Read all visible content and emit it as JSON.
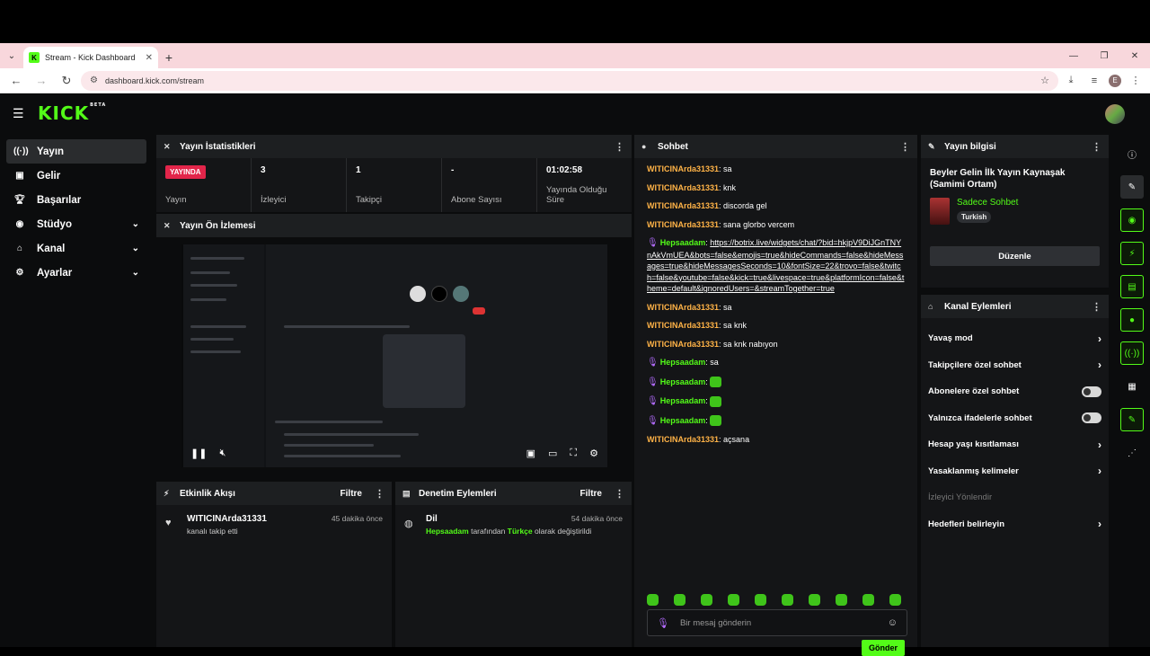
{
  "browser": {
    "tab_title": "Stream - Kick Dashboard",
    "url": "dashboard.kick.com/stream",
    "profile_letter": "E"
  },
  "app": {
    "logo": "KICK",
    "logo_badge": "BETA"
  },
  "sidebar": {
    "items": [
      {
        "label": "Yayın",
        "icon": "broadcast-icon",
        "active": true
      },
      {
        "label": "Gelir",
        "icon": "revenue-icon"
      },
      {
        "label": "Başarılar",
        "icon": "trophy-icon"
      },
      {
        "label": "Stüdyo",
        "icon": "studio-icon"
      },
      {
        "label": "Kanal",
        "icon": "channel-icon"
      },
      {
        "label": "Ayarlar",
        "icon": "settings-icon"
      }
    ]
  },
  "stats": {
    "title": "Yayın İstatistikleri",
    "live_badge": "YAYINDA",
    "items": [
      {
        "value": "",
        "label": "Yayın"
      },
      {
        "value": "3",
        "label": "İzleyici"
      },
      {
        "value": "1",
        "label": "Takipçi"
      },
      {
        "value": "-",
        "label": "Abone Sayısı"
      },
      {
        "value": "01:02:58",
        "label": "Yayında Olduğu Süre"
      }
    ]
  },
  "preview": {
    "title": "Yayın Ön İzlemesi"
  },
  "activity": {
    "title": "Etkinlik Akışı",
    "filter": "Filtre",
    "user": "WITICINArda31331",
    "time": "45 dakika önce",
    "desc": "kanalı takip etti"
  },
  "moderation": {
    "title": "Denetim Eylemleri",
    "filter": "Filtre",
    "item": "Dil",
    "time": "54 dakika önce",
    "actor": "Hepsaadam",
    "middle": "tarafından",
    "lang": "Türkçe",
    "end": "olarak değiştirildi"
  },
  "chat": {
    "title": "Sohbet",
    "messages": [
      {
        "user": "WITICINArda31331",
        "text": "sa"
      },
      {
        "user": "WITICINArda31331",
        "text": "knk"
      },
      {
        "user": "WITICINArda31331",
        "text": "discorda gel"
      },
      {
        "user": "WITICINArda31331",
        "text": "sana glorbo vercem"
      },
      {
        "user": "Hepsaadam",
        "text": "https://botrix.live/widgets/chat/?bid=hkjpV9DiJGnTNYnAkVmUEA&bots=false&emojis=true&hideCommands=false&hideMessages=true&hideMessagesSeconds=10&fontSize=22&trovo=false&twitch=false&youtube=false&kick=true&livespace=true&platformIcon=false&theme=default&ignoredUsers=&streamTogether=true"
      },
      {
        "user": "WITICINArda31331",
        "text": "sa"
      },
      {
        "user": "WITICINArda31331",
        "text": "sa knk"
      },
      {
        "user": "WITICINArda31331",
        "text": "sa knk nabıyon"
      },
      {
        "user": "Hepsaadam",
        "text": "sa"
      },
      {
        "user": "Hepsaadam",
        "text": ""
      },
      {
        "user": "Hepsaadam",
        "text": ""
      },
      {
        "user": "Hepsaadam",
        "text": ""
      },
      {
        "user": "WITICINArda31331",
        "text": "açsana"
      }
    ],
    "placeholder": "Bir mesaj gönderin",
    "send": "Gönder"
  },
  "info": {
    "title": "Yayın bilgisi",
    "stream_title": "Beyler Gelin İlk Yayın Kaynaşak (Samimi Ortam)",
    "category": "Sadece Sohbet",
    "tag": "Turkish",
    "edit": "Düzenle"
  },
  "channel_actions": {
    "title": "Kanal Eylemleri",
    "items": [
      {
        "label": "Yavaş mod",
        "type": "arrow"
      },
      {
        "label": "Takipçilere özel sohbet",
        "type": "arrow"
      },
      {
        "label": "Abonelere özel sohbet",
        "type": "toggle"
      },
      {
        "label": "Yalnızca ifadelerle sohbet",
        "type": "toggle"
      },
      {
        "label": "Hesap yaşı kısıtlaması",
        "type": "arrow"
      },
      {
        "label": "Yasaklanmış kelimeler",
        "type": "arrow"
      },
      {
        "label": "İzleyici Yönlendir",
        "type": "disabled"
      },
      {
        "label": "Hedefleri belirleyin",
        "type": "arrow"
      }
    ]
  },
  "colors": {
    "accent": "#53fc18",
    "live": "#e2254a",
    "user_orange": "#ffb347"
  }
}
